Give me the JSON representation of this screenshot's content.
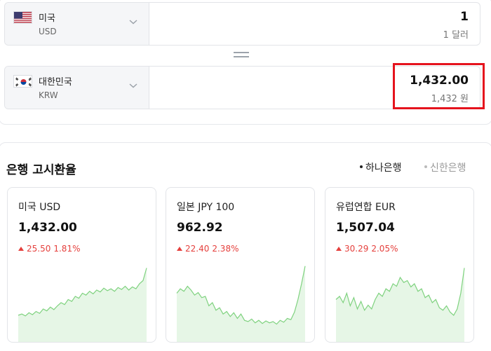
{
  "converter": {
    "from": {
      "name": "미국",
      "code": "USD",
      "amount": "1",
      "amount_text": "1 달러",
      "flag": "us-flag-icon"
    },
    "to": {
      "name": "대한민국",
      "code": "KRW",
      "amount": "1,432.00",
      "amount_text": "1,432 원",
      "flag": "kr-flag-icon"
    },
    "equals_icon": "equals-icon"
  },
  "bank_rates": {
    "title": "은행 고시환율",
    "tabs": [
      {
        "label": "하나은행",
        "active": true
      },
      {
        "label": "신한은행",
        "active": false
      }
    ],
    "cards": [
      {
        "title": "미국 USD",
        "value": "1,432.00",
        "change": "25.50",
        "percent": "1.81%",
        "direction": "up"
      },
      {
        "title": "일본 JPY 100",
        "value": "962.92",
        "change": "22.40",
        "percent": "2.38%",
        "direction": "up"
      },
      {
        "title": "유럽연합 EUR",
        "value": "1,507.04",
        "change": "30.29",
        "percent": "2.05%",
        "direction": "up"
      }
    ]
  },
  "colors": {
    "up": "#e5403d",
    "spark_line": "#7fd27f",
    "spark_fill": "#e6f6e6",
    "highlight": "#e5131d"
  },
  "sparklines": [
    [
      0.2,
      0.22,
      0.19,
      0.24,
      0.21,
      0.26,
      0.23,
      0.3,
      0.27,
      0.33,
      0.29,
      0.35,
      0.4,
      0.37,
      0.45,
      0.42,
      0.5,
      0.47,
      0.55,
      0.52,
      0.58,
      0.54,
      0.6,
      0.57,
      0.63,
      0.59,
      0.62,
      0.58,
      0.64,
      0.61,
      0.66,
      0.6,
      0.65,
      0.62,
      0.7,
      0.75,
      0.95
    ],
    [
      0.55,
      0.62,
      0.58,
      0.66,
      0.6,
      0.52,
      0.56,
      0.48,
      0.5,
      0.35,
      0.4,
      0.28,
      0.32,
      0.22,
      0.26,
      0.18,
      0.24,
      0.15,
      0.22,
      0.12,
      0.1,
      0.14,
      0.08,
      0.12,
      0.07,
      0.11,
      0.08,
      0.1,
      0.06,
      0.12,
      0.09,
      0.15,
      0.13,
      0.25,
      0.45,
      0.7,
      0.98
    ],
    [
      0.45,
      0.5,
      0.4,
      0.55,
      0.35,
      0.48,
      0.3,
      0.42,
      0.28,
      0.36,
      0.3,
      0.45,
      0.55,
      0.5,
      0.62,
      0.58,
      0.7,
      0.66,
      0.8,
      0.72,
      0.75,
      0.65,
      0.7,
      0.58,
      0.62,
      0.48,
      0.52,
      0.4,
      0.45,
      0.32,
      0.28,
      0.35,
      0.25,
      0.2,
      0.3,
      0.55,
      0.95
    ]
  ]
}
